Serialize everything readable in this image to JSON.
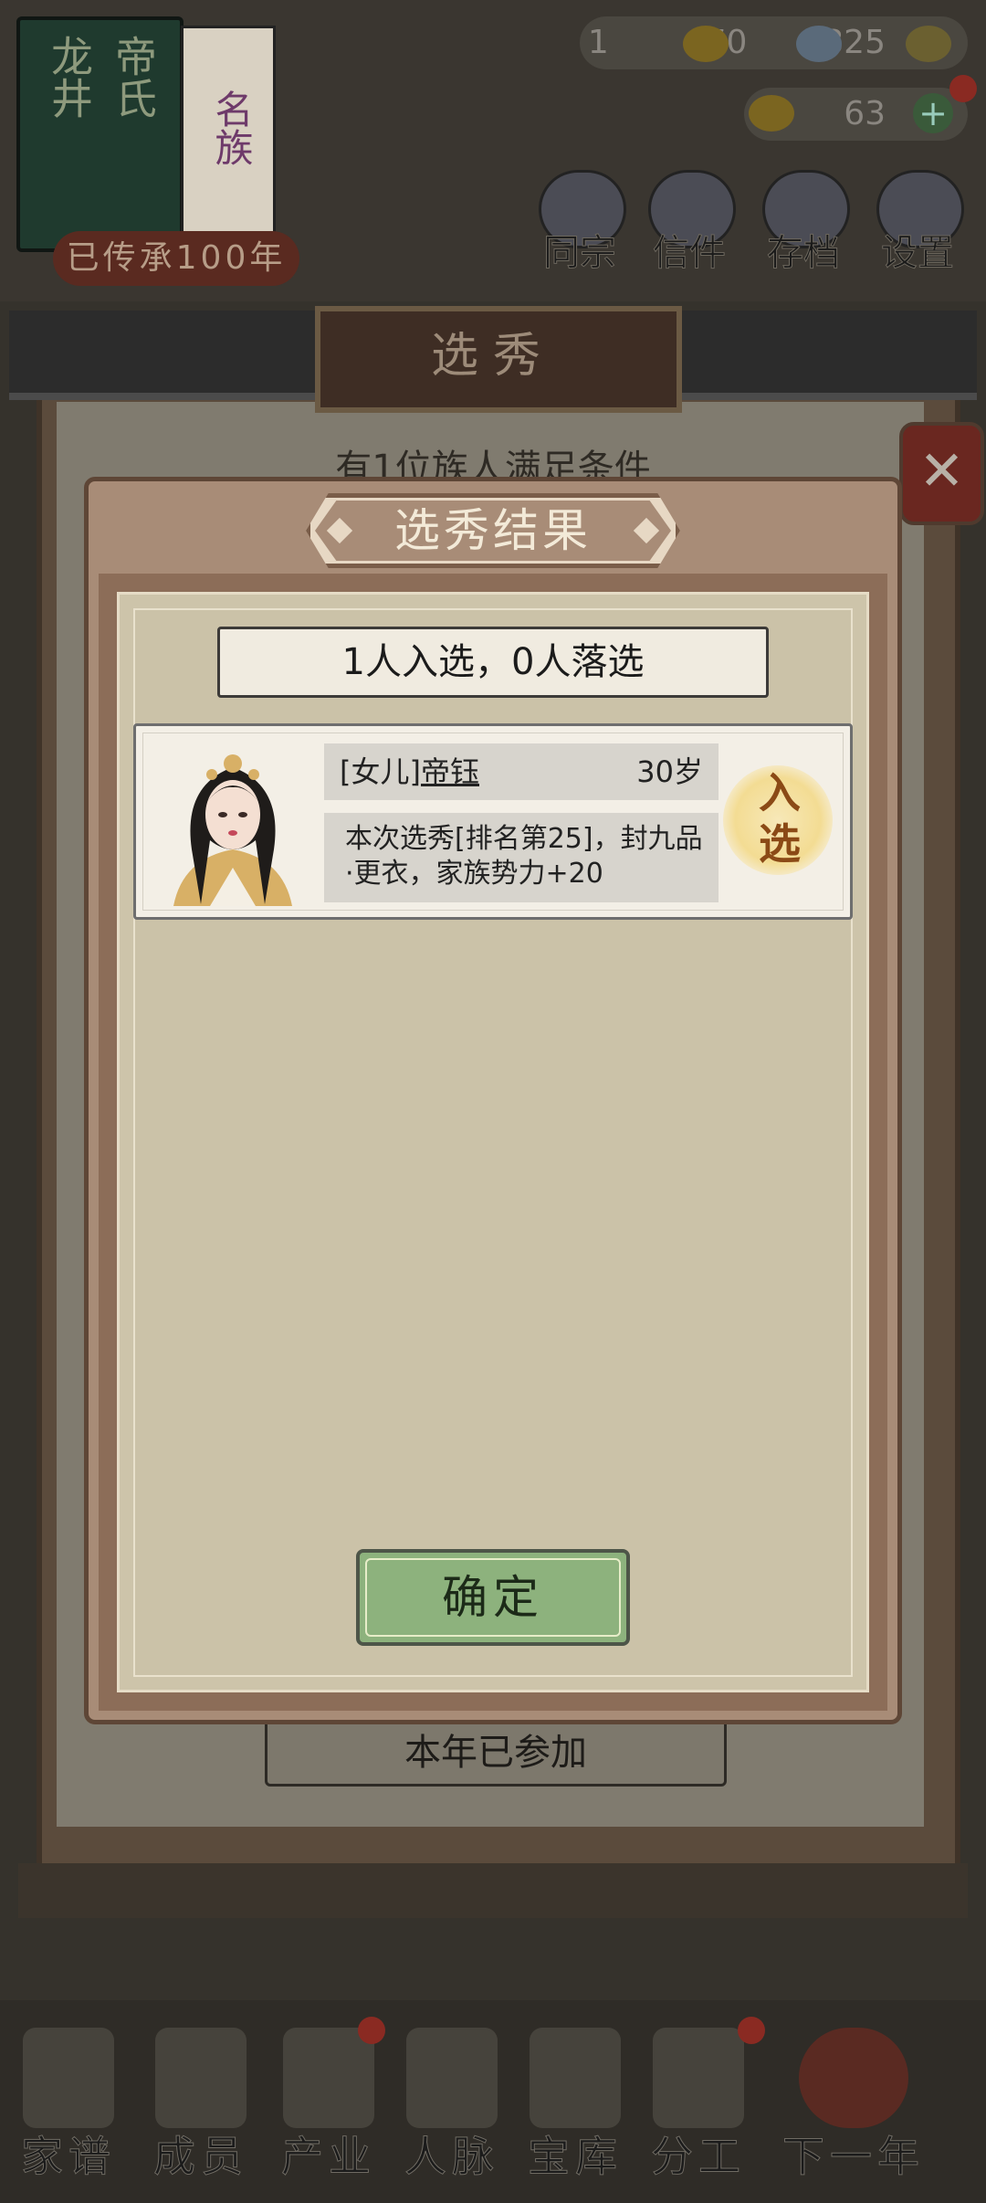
{
  "book": {
    "cover_left": "龙井",
    "cover_right": "帝氏",
    "page_name": "名族",
    "banner": "已传承100年"
  },
  "resources": {
    "val1": "1",
    "val2": "670",
    "val3": "825",
    "val4": "63",
    "icons": [
      "ingot-icon",
      "silver-icon",
      "coin-icon",
      "gold-icon",
      "plus-icon"
    ]
  },
  "top_menu": {
    "items": [
      {
        "label": "同宗"
      },
      {
        "label": "信件"
      },
      {
        "label": "存档"
      },
      {
        "label": "设置"
      }
    ]
  },
  "selection_panel": {
    "title": "选秀",
    "description": "有1位族人满足条件",
    "joined_label": "本年已参加"
  },
  "modal": {
    "title": "选秀结果",
    "summary": "1人入选，0人落选",
    "result": {
      "relation": "[女儿]",
      "name": "帝钰",
      "age": "30岁",
      "description": "本次选秀[排名第25]，封九品·更衣，家族势力+20",
      "stamp": "入选"
    },
    "confirm_label": "确定"
  },
  "bottom_nav": {
    "items": [
      {
        "label": "家谱"
      },
      {
        "label": "成员"
      },
      {
        "label": "产业"
      },
      {
        "label": "人脉"
      },
      {
        "label": "宝库"
      },
      {
        "label": "分工"
      },
      {
        "label": "下一年"
      }
    ]
  },
  "colors": {
    "modal_bg": "#a88c77",
    "paper_bg": "#cdc4aa",
    "confirm_bg": "#8db27d",
    "stamp_text": "#8b4a16"
  }
}
